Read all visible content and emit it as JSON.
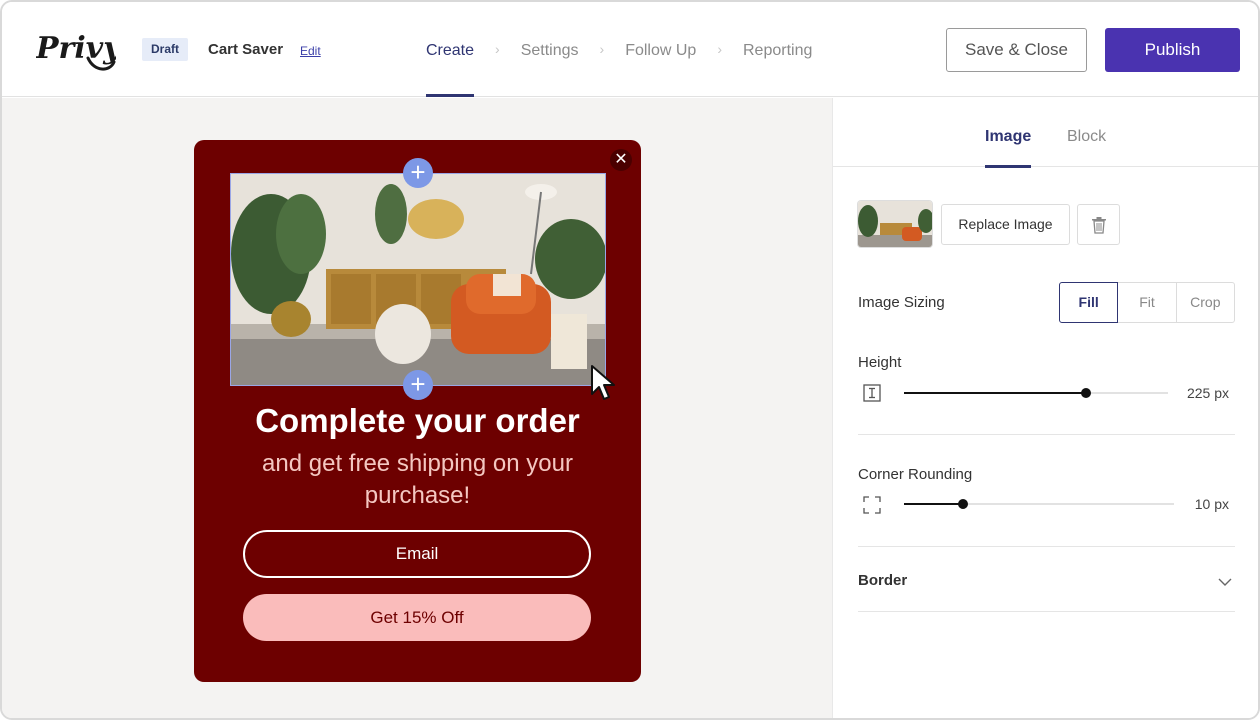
{
  "header": {
    "logo_text": "Privy",
    "badge": "Draft",
    "campaign_name": "Cart Saver",
    "edit_label": "Edit",
    "steps": [
      {
        "label": "Create",
        "active": true
      },
      {
        "label": "Settings",
        "active": false
      },
      {
        "label": "Follow Up",
        "active": false
      },
      {
        "label": "Reporting",
        "active": false
      }
    ],
    "save_close_label": "Save & Close",
    "publish_label": "Publish",
    "accent_color": "#4a33b0"
  },
  "popup": {
    "close_icon": "close-icon",
    "background_color": "#6d0000",
    "title": "Complete your order",
    "subtitle": "and get free shipping on your purchase!",
    "email_placeholder": "Email",
    "cta_label": "Get 15% Off",
    "cta_color": "#fabcbb"
  },
  "panel": {
    "tabs": [
      {
        "label": "Image",
        "active": true
      },
      {
        "label": "Block",
        "active": false
      }
    ],
    "replace_image_label": "Replace Image",
    "image_sizing": {
      "label": "Image Sizing",
      "options": [
        "Fill",
        "Fit",
        "Crop"
      ],
      "selected": "Fill"
    },
    "height": {
      "label": "Height",
      "value_text": "225 px",
      "level": 0.69
    },
    "corner_rounding": {
      "label": "Corner Rounding",
      "value_text": "10 px",
      "level": 0.22
    },
    "border_label": "Border"
  }
}
